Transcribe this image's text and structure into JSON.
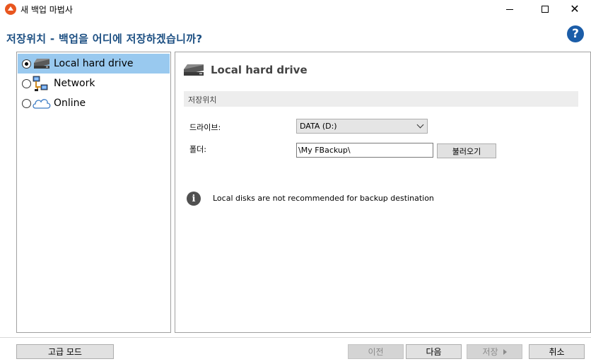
{
  "window": {
    "title": "새 백업 마법사",
    "minimize_glyph": "",
    "close_glyph": "✕"
  },
  "header": {
    "title": "저장위치 - 백업을 어디에 저장하겠습니까?",
    "help_glyph": "?"
  },
  "destinations": {
    "selected_index": 0,
    "items": [
      {
        "label": "Local hard drive",
        "icon": "hard-drive-icon"
      },
      {
        "label": "Network",
        "icon": "network-icon"
      },
      {
        "label": "Online",
        "icon": "cloud-icon"
      }
    ]
  },
  "detail": {
    "title": "Local hard drive",
    "section_label": "저장위치",
    "drive_label": "드라이브:",
    "drive_value": "DATA (D:)",
    "folder_label": "폴더:",
    "folder_value": "\\My FBackup\\",
    "browse_label": "불러오기",
    "info_glyph": "i",
    "info_text": "Local disks are not recommended for backup destination"
  },
  "footer": {
    "advanced_label": "고급 모드",
    "prev_label": "이전",
    "next_label": "다음",
    "save_label": "저장",
    "cancel_label": "취소"
  },
  "colors": {
    "accent_title": "#1c4f82",
    "selection": "#99c9ef",
    "help": "#1b5da8",
    "app_icon": "#e8561f"
  }
}
